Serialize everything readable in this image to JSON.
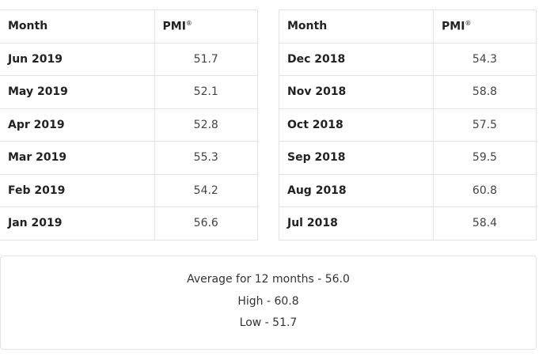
{
  "tables": {
    "left": {
      "header": {
        "month": "Month",
        "pmi": "PMI",
        "pmi_mark": "®"
      },
      "rows": [
        {
          "month": "Jun 2019",
          "value": "51.7"
        },
        {
          "month": "May 2019",
          "value": "52.1"
        },
        {
          "month": "Apr 2019",
          "value": "52.8"
        },
        {
          "month": "Mar 2019",
          "value": "55.3"
        },
        {
          "month": "Feb 2019",
          "value": "54.2"
        },
        {
          "month": "Jan 2019",
          "value": "56.6"
        }
      ]
    },
    "right": {
      "header": {
        "month": "Month",
        "pmi": "PMI",
        "pmi_mark": "®"
      },
      "rows": [
        {
          "month": "Dec 2018",
          "value": "54.3"
        },
        {
          "month": "Nov 2018",
          "value": "58.8"
        },
        {
          "month": "Oct 2018",
          "value": "57.5"
        },
        {
          "month": "Sep 2018",
          "value": "59.5"
        },
        {
          "month": "Aug 2018",
          "value": "60.8"
        },
        {
          "month": "Jul 2018",
          "value": "58.4"
        }
      ]
    }
  },
  "summary": {
    "average": "Average for 12 months - 56.0",
    "high": "High - 60.8",
    "low": "Low - 51.7"
  }
}
